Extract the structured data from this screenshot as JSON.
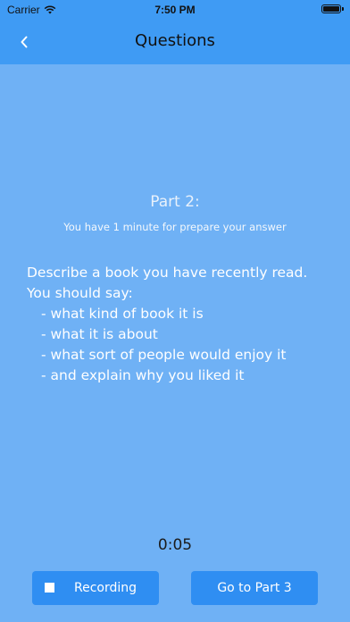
{
  "status_bar": {
    "carrier": "Carrier",
    "time": "7:50 PM",
    "wifi_icon": "wifi-icon",
    "battery_icon": "battery-icon"
  },
  "nav": {
    "title": "Questions",
    "back_icon": "chevron-left-icon"
  },
  "part": {
    "title": "Part 2:",
    "subtitle": "You have 1 minute for prepare your answer"
  },
  "question": {
    "lines": [
      "Describe a book you have recently read.",
      "You should say:"
    ],
    "bullets": [
      "- what kind of book it is",
      "- what it is about",
      "- what sort of people would enjoy it",
      "- and explain why you liked it"
    ]
  },
  "timer": "0:05",
  "buttons": {
    "record_label": "Recording",
    "record_icon": "stop-icon",
    "next_label": "Go to Part 3"
  },
  "colors": {
    "background": "#6fb1f5",
    "header": "#3f9bf4",
    "button": "#2f8ef2"
  }
}
